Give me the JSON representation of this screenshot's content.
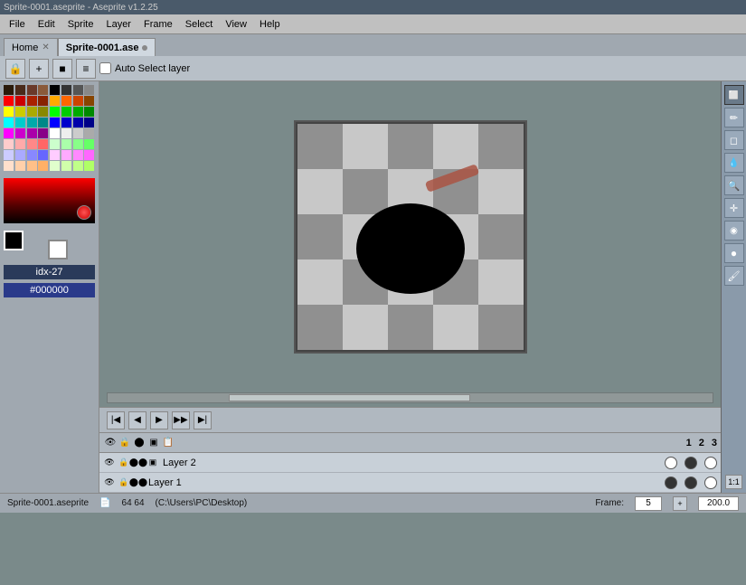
{
  "title_bar": {
    "text": "Sprite-0001.aseprite - Aseprite v1.2.25"
  },
  "menu": {
    "items": [
      "File",
      "Edit",
      "Sprite",
      "Layer",
      "Frame",
      "Select",
      "View",
      "Help"
    ]
  },
  "tabs": [
    {
      "label": "Home",
      "closeable": true,
      "active": false
    },
    {
      "label": "Sprite-0001.ase",
      "closeable": false,
      "active": true,
      "modified": true
    }
  ],
  "toolbar": {
    "auto_select_label": "Auto Select layer",
    "buttons": [
      "lock",
      "plus",
      "square",
      "list"
    ]
  },
  "palette": {
    "colors": [
      "#2a1a0a",
      "#4a2a1a",
      "#6a3a2a",
      "#8a5a3a",
      "#000000",
      "#333333",
      "#555555",
      "#888888",
      "#ff0000",
      "#cc0000",
      "#aa2200",
      "#882200",
      "#ffaa00",
      "#ff6600",
      "#cc4400",
      "#884400",
      "#ffff00",
      "#cccc00",
      "#aaaa00",
      "#888800",
      "#00ff00",
      "#00cc00",
      "#00aa00",
      "#008800",
      "#00ffff",
      "#00cccc",
      "#00aaaa",
      "#008888",
      "#0000ff",
      "#0000cc",
      "#0000aa",
      "#000088",
      "#ff00ff",
      "#cc00cc",
      "#aa00aa",
      "#880088",
      "#ffffff",
      "#eeeeee",
      "#cccccc",
      "#aaaaaa",
      "#ffcccc",
      "#ffaaaa",
      "#ff8888",
      "#ff6666",
      "#ccffcc",
      "#aaffaa",
      "#88ff88",
      "#66ff66",
      "#ccccff",
      "#aaaaff",
      "#8888ff",
      "#6666ff",
      "#ffccff",
      "#ffaaff",
      "#ff88ff",
      "#ff66ff",
      "#ffe0cc",
      "#ffd0aa",
      "#ffc088",
      "#ffb066",
      "#e0ffcc",
      "#d0ffaa",
      "#c0ff88",
      "#b0ff66"
    ]
  },
  "fg_color": "#000000",
  "bg_color": "#ffffff",
  "color_label": "idx-27",
  "color_hex": "#000000",
  "canvas": {
    "width": 64,
    "height": 64
  },
  "tools": {
    "right_panel": [
      {
        "name": "select-rect",
        "icon": "⬜",
        "label": "rectangle-select"
      },
      {
        "name": "pencil",
        "icon": "✏",
        "label": "pencil-tool"
      },
      {
        "name": "eraser",
        "icon": "◻",
        "label": "eraser-tool"
      },
      {
        "name": "dropper",
        "icon": "💧",
        "label": "eyedropper-tool"
      },
      {
        "name": "zoom",
        "icon": "🔍",
        "label": "zoom-tool"
      },
      {
        "name": "move",
        "icon": "✛",
        "label": "move-tool"
      },
      {
        "name": "fill",
        "icon": "◉",
        "label": "fill-tool"
      },
      {
        "name": "shape",
        "icon": "●",
        "label": "shape-tool"
      },
      {
        "name": "brush",
        "icon": "🖌",
        "label": "brush-tool"
      }
    ]
  },
  "frame_controls": {
    "buttons": [
      {
        "icon": "|◀",
        "label": "first-frame"
      },
      {
        "icon": "◀",
        "label": "prev-frame"
      },
      {
        "icon": "▶",
        "label": "play"
      },
      {
        "icon": "▶▶",
        "label": "next-frame"
      },
      {
        "icon": "▶|",
        "label": "last-frame"
      }
    ]
  },
  "layers": {
    "header": {
      "frame_numbers": [
        "1",
        "2",
        "3"
      ]
    },
    "rows": [
      {
        "name": "Layer 2",
        "visible": true,
        "locked": true,
        "frames": [
          false,
          true,
          false
        ]
      },
      {
        "name": "Layer 1",
        "visible": true,
        "locked": true,
        "frames": [
          true,
          true,
          false
        ]
      }
    ]
  },
  "status_bar": {
    "filename": "Sprite-0001.aseprite",
    "dimensions": "64 64",
    "path": "(C:\\Users\\PC\\Desktop)",
    "frame_label": "Frame:",
    "frame_value": "5",
    "zoom_value": "200.0",
    "ratio": "1:1"
  }
}
